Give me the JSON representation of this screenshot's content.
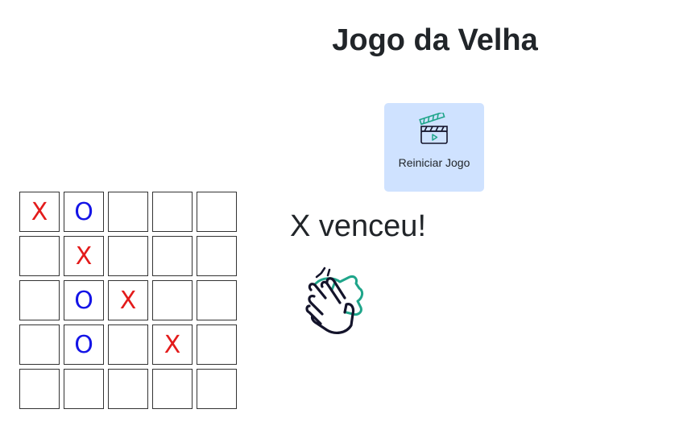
{
  "title": "Jogo da Velha",
  "restart_button": {
    "label": "Reiniciar Jogo",
    "icon": "clapperboard-icon"
  },
  "status": "X venceu!",
  "celebration_icon": "clapping-hands-icon",
  "colors": {
    "x": "#e31b1b",
    "o": "#1414e6",
    "button_bg": "#cfe2ff",
    "icon_accent": "#1fa58a",
    "icon_dark": "#14142b"
  },
  "board": [
    [
      "X",
      "O",
      "",
      "",
      ""
    ],
    [
      "",
      "X",
      "",
      "",
      ""
    ],
    [
      "",
      "O",
      "X",
      "",
      ""
    ],
    [
      "",
      "O",
      "",
      "X",
      ""
    ],
    [
      "",
      "",
      "",
      "",
      ""
    ]
  ]
}
